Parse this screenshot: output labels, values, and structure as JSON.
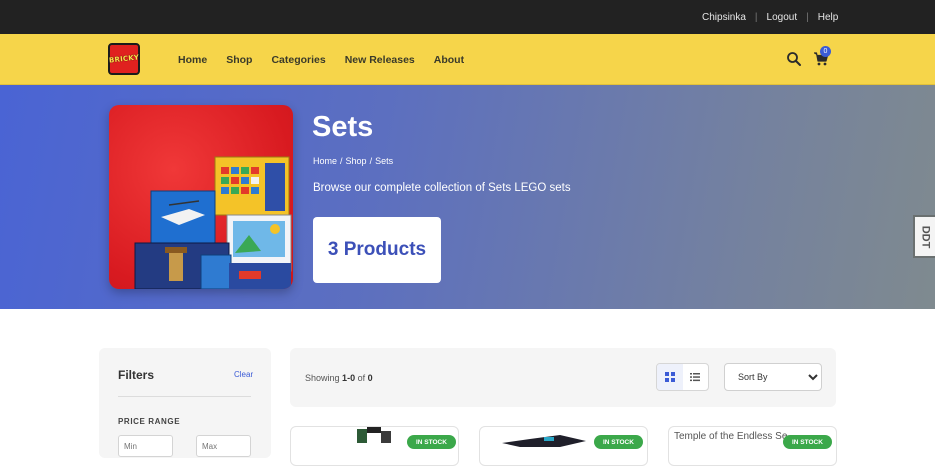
{
  "topbar": {
    "user": "Chipsinka",
    "logout": "Logout",
    "help": "Help"
  },
  "nav": {
    "logo_text": "BRICKY",
    "menu": [
      "Home",
      "Shop",
      "Categories",
      "New Releases",
      "About"
    ],
    "cart_count": "0",
    "icons": [
      "search-icon",
      "cart-icon"
    ],
    "accent_color": "#f6d54a"
  },
  "hero": {
    "title": "Sets",
    "breadcrumb": [
      "Home",
      "/",
      "Shop",
      "/",
      "Sets"
    ],
    "description": "Browse our complete collection of Sets LEGO sets",
    "count_label": "3 Products",
    "side_tab": "DDT"
  },
  "filters": {
    "title": "Filters",
    "clear": "Clear",
    "price_range_label": "PRICE RANGE",
    "min_placeholder": "Min",
    "max_placeholder": "Max"
  },
  "toolbar": {
    "showing_prefix": "Showing",
    "range_start": "1",
    "range_sep": "-",
    "range_end": "0",
    "of_word": "of",
    "total": "0",
    "sort_selected": "Sort By"
  },
  "products": [
    {
      "badge": "IN STOCK",
      "image_alt": ""
    },
    {
      "badge": "IN STOCK",
      "image_alt": ""
    },
    {
      "badge": "IN STOCK",
      "image_alt": "Temple of the Endless Se"
    }
  ],
  "colors": {
    "brand_blue": "#3b5bd6",
    "in_stock_green": "#3ba84a",
    "topbar": "#222222"
  }
}
